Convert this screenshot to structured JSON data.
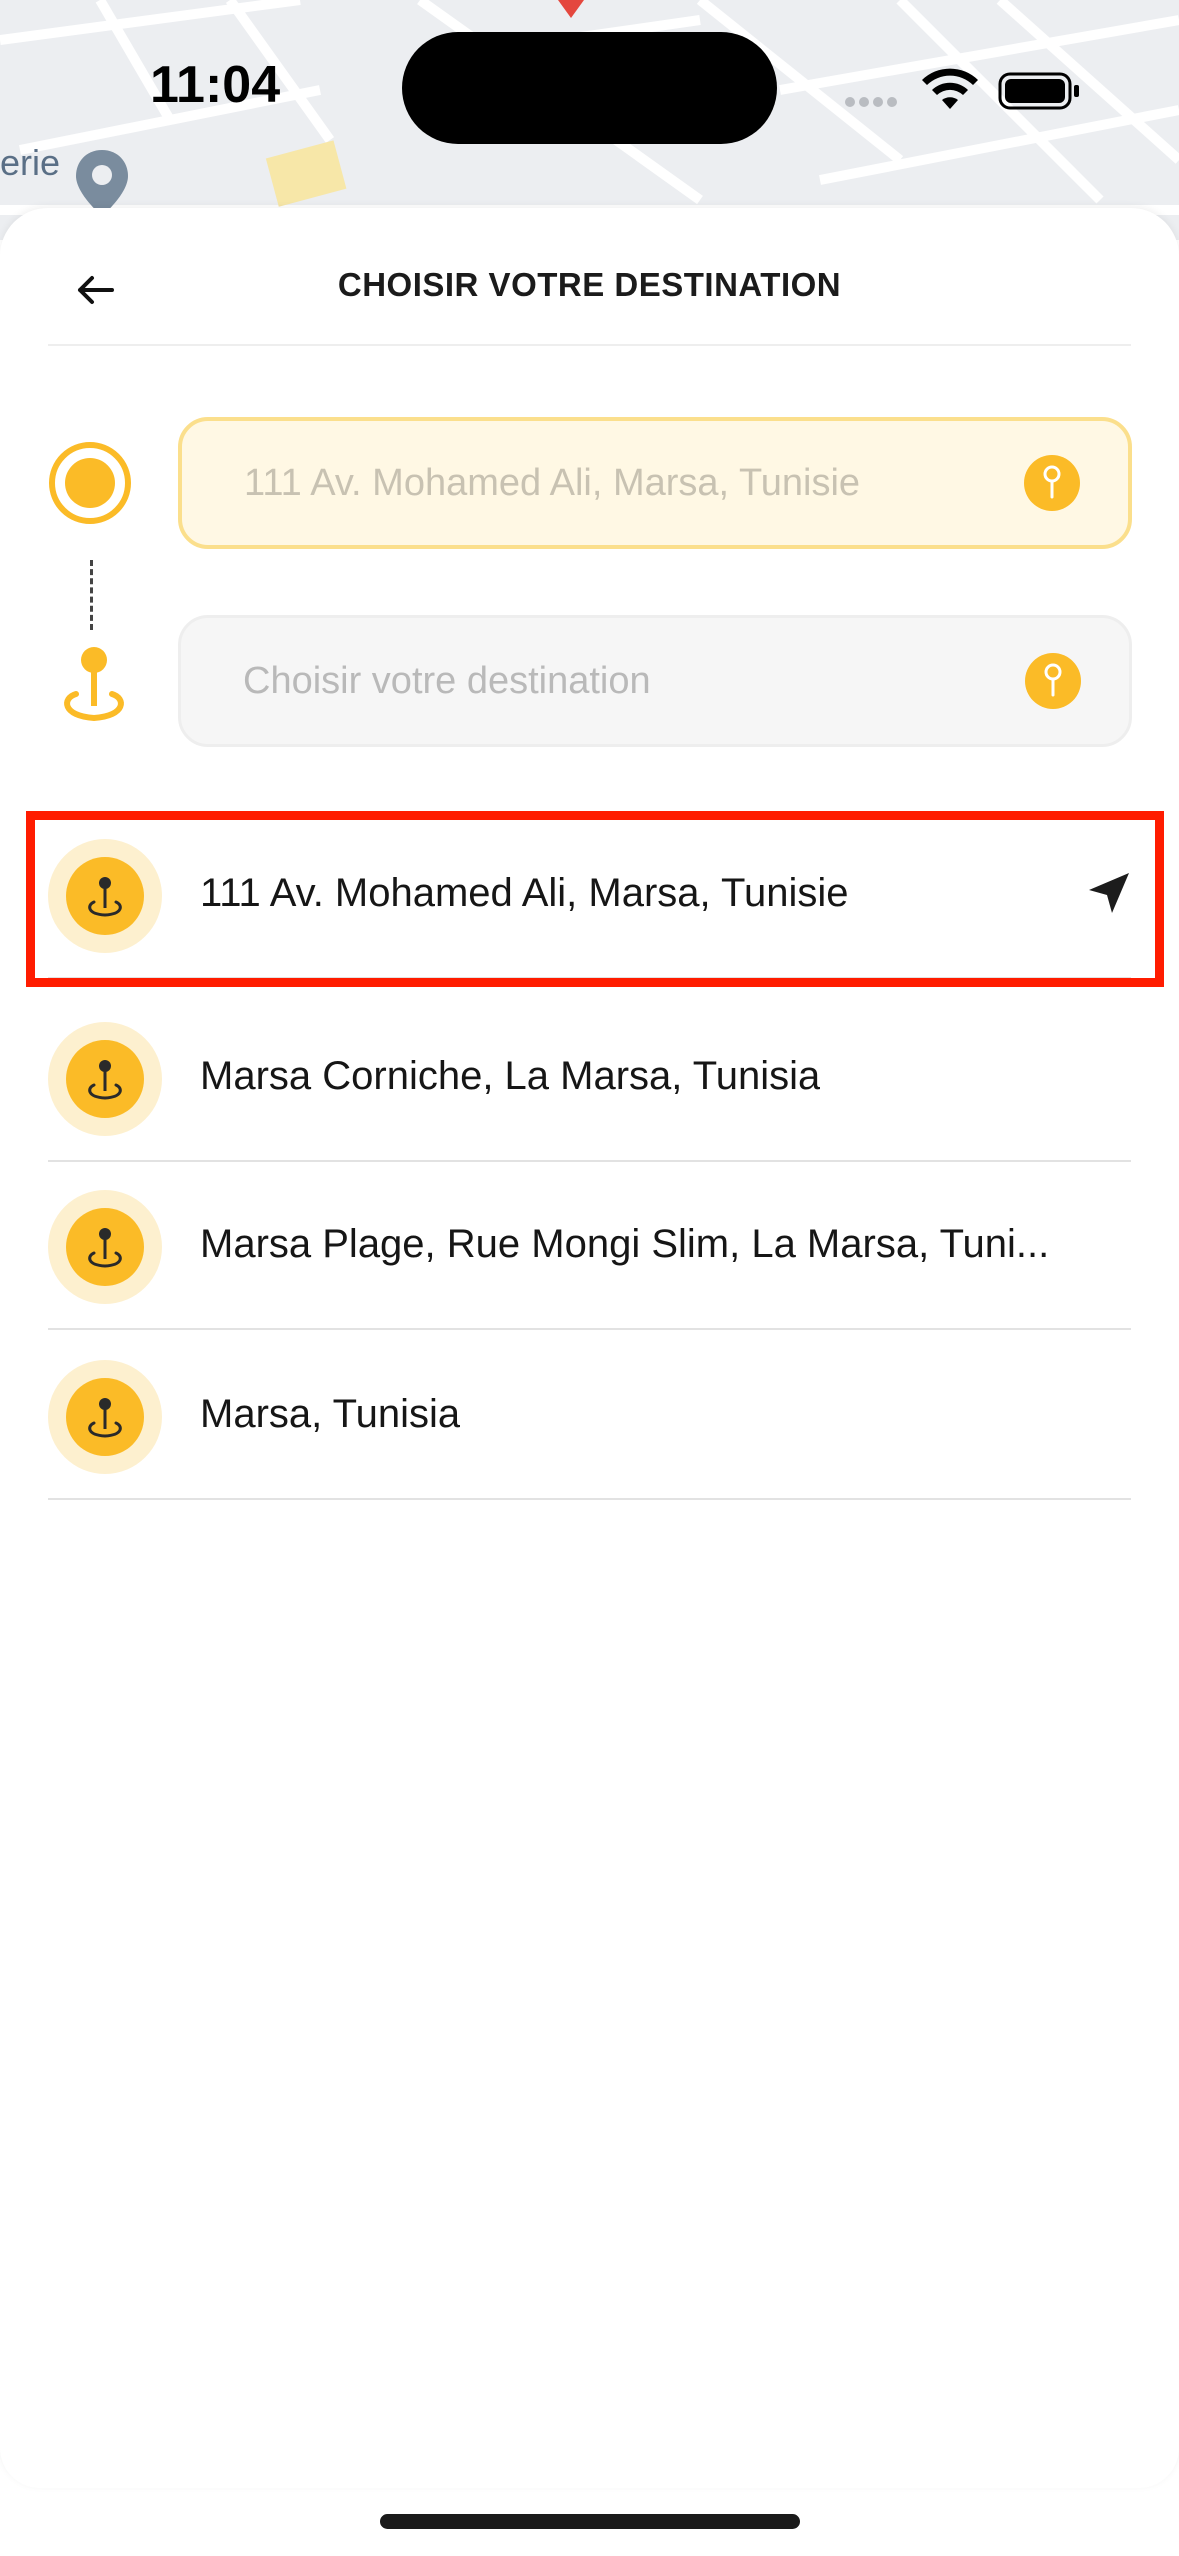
{
  "status": {
    "time": "11:04"
  },
  "map": {
    "poi_label": "erie"
  },
  "header": {
    "title": "CHOISIR VOTRE DESTINATION"
  },
  "route": {
    "origin_value": "111 Av. Mohamed Ali, Marsa, Tunisie",
    "destination_placeholder": "Choisir votre destination"
  },
  "suggestions": [
    {
      "label": "111 Av. Mohamed Ali, Marsa, Tunisie",
      "icon": "location-arrow-icon"
    },
    {
      "label": "Marsa Corniche, La Marsa, Tunisia"
    },
    {
      "label": "Marsa Plage, Rue Mongi Slim, La Marsa, Tuni..."
    },
    {
      "label": "Marsa, Tunisia"
    }
  ],
  "colors": {
    "accent": "#fbbb27",
    "accent_light": "#fdf0cf",
    "highlight": "#ff1c00"
  }
}
